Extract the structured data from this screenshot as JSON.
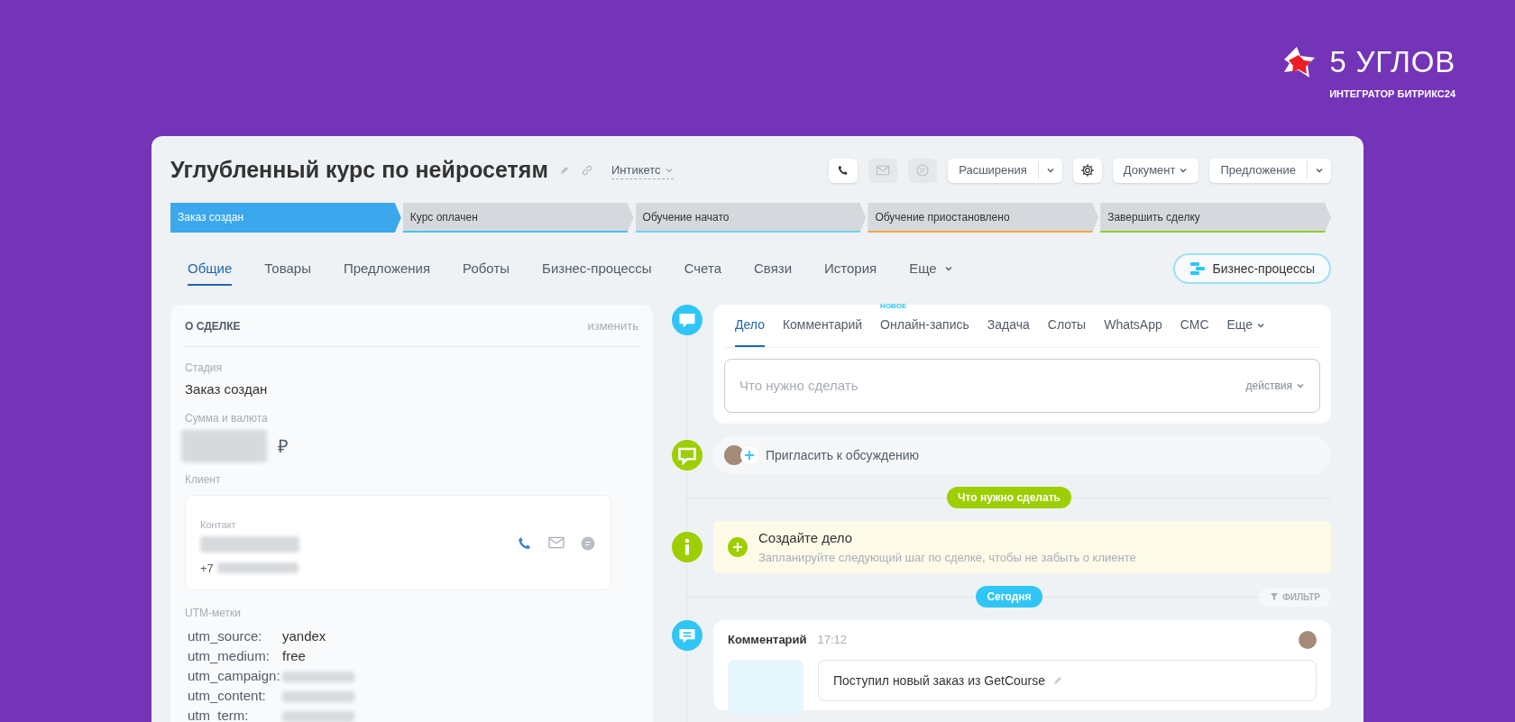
{
  "brand": {
    "name": "5 УГЛОВ",
    "tagline": "ИНТЕГРАТОР БИТРИКС24"
  },
  "deal": {
    "title": "Углубленный курс по нейросетям",
    "category": "Интикетс"
  },
  "toolbar": [
    {
      "kind": "phone",
      "disabled": false
    },
    {
      "kind": "mail",
      "disabled": true
    },
    {
      "kind": "chat",
      "disabled": true
    },
    {
      "kind": "split",
      "label": "Расширения"
    },
    {
      "kind": "gear",
      "disabled": false
    },
    {
      "kind": "dropdown",
      "label": "Документ"
    },
    {
      "kind": "split",
      "label": "Предложение"
    }
  ],
  "stages": [
    {
      "label": "Заказ создан",
      "selected": true,
      "color": "#3ba7ec"
    },
    {
      "label": "Курс оплачен",
      "selected": false,
      "color": "#47c2f0"
    },
    {
      "label": "Обучение начато",
      "selected": false,
      "color": "#6fd3f4"
    },
    {
      "label": "Обучение приостановлено",
      "selected": false,
      "color": "#f2a64a"
    },
    {
      "label": "Завершить сделку",
      "selected": false,
      "color": "#8fcf2a"
    }
  ],
  "tabs": [
    {
      "label": "Общие",
      "selected": true,
      "kind": "tab"
    },
    {
      "label": "Товары",
      "selected": false,
      "kind": "tab"
    },
    {
      "label": "Предложения",
      "selected": false,
      "kind": "tab"
    },
    {
      "label": "Роботы",
      "selected": false,
      "kind": "tab"
    },
    {
      "label": "Бизнес-процессы",
      "selected": false,
      "kind": "tab"
    },
    {
      "label": "Счета",
      "selected": false,
      "kind": "tab"
    },
    {
      "label": "Связи",
      "selected": false,
      "kind": "tab"
    },
    {
      "label": "История",
      "selected": false,
      "kind": "tab"
    },
    {
      "label": "Еще",
      "selected": false,
      "kind": "more"
    }
  ],
  "bp_button": "Бизнес-процессы",
  "about": {
    "heading": "О СДЕЛКЕ",
    "edit": "изменить",
    "stage": {
      "label": "Стадия",
      "value": "Заказ создан"
    },
    "amount": {
      "label": "Сумма и валюта",
      "currency": "₽"
    },
    "client": {
      "label": "Клиент",
      "contact_label": "Контакт",
      "phone_prefix": "+7"
    },
    "utm": {
      "label": "UTM-метки",
      "rows": [
        {
          "key": "utm_source:",
          "value": "yandex",
          "blurred": false
        },
        {
          "key": "utm_medium:",
          "value": "free",
          "blurred": false
        },
        {
          "key": "utm_campaign:",
          "blurred": true
        },
        {
          "key": "utm_content:",
          "blurred": true
        },
        {
          "key": "utm_term:",
          "blurred": true
        }
      ]
    }
  },
  "timeline": [
    {
      "kind": "composer",
      "color": "#2fc6f6",
      "tabs": [
        {
          "label": "Дело",
          "selected": true
        },
        {
          "label": "Комментарий",
          "selected": false
        },
        {
          "label": "Онлайн-запись",
          "selected": false,
          "badge": "НОВОЕ"
        },
        {
          "label": "Задача",
          "selected": false
        },
        {
          "label": "Слоты",
          "selected": false
        },
        {
          "label": "WhatsApp",
          "selected": false
        },
        {
          "label": "СМС",
          "selected": false
        },
        {
          "label": "Еще",
          "selected": false,
          "more": true
        }
      ],
      "placeholder": "Что нужно сделать",
      "actions": "действия"
    },
    {
      "kind": "invite",
      "color": "#9dcf00",
      "text": "Пригласить к обсуждению"
    },
    {
      "kind": "divider",
      "color": "#9dcf00",
      "text": "Что нужно сделать"
    },
    {
      "kind": "todo",
      "color": "#9dcf00",
      "title": "Создайте дело",
      "subtitle": "Запланируйте следующий шаг по сделке, чтобы не забыть о клиенте"
    },
    {
      "kind": "divider",
      "color": "#2fc6f6",
      "text": "Сегодня",
      "filter": "ФИЛЬТР"
    },
    {
      "kind": "comment",
      "color": "#2fc6f6",
      "title": "Комментарий",
      "time": "17:12",
      "text": "Поступил новый заказ из GetCourse"
    }
  ]
}
